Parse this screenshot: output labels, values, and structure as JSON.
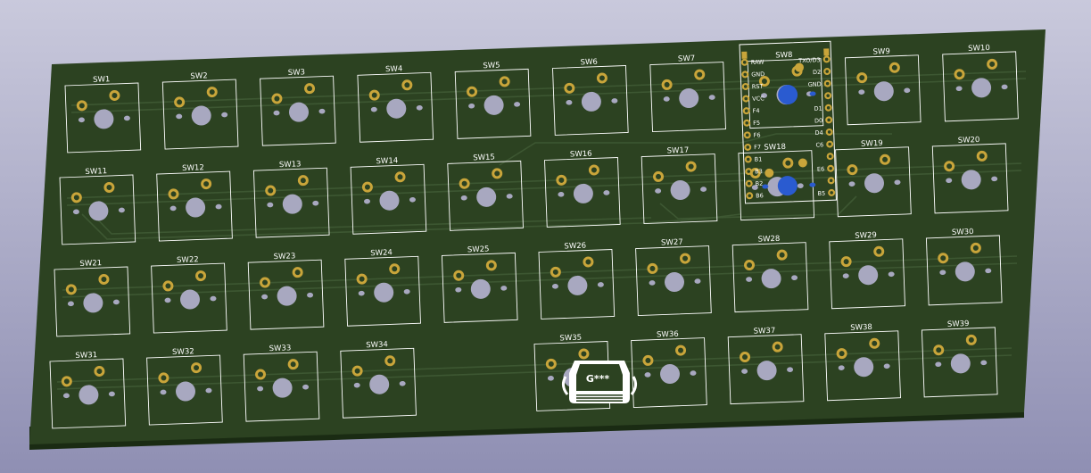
{
  "colors": {
    "background_top": "#c9c9dc",
    "background_bottom": "#8f8fb3",
    "board": "#2c4221",
    "board_edge": "#1a2b13",
    "trace": "#3f5a34",
    "silkscreen": "#ffffff",
    "pad_gold": "#c9a53a",
    "hole": "#a8a8c0",
    "mcu_hole": "#2a5bd0"
  },
  "switches": [
    {
      "label": "SW1"
    },
    {
      "label": "SW2"
    },
    {
      "label": "SW3"
    },
    {
      "label": "SW4"
    },
    {
      "label": "SW5"
    },
    {
      "label": "SW6"
    },
    {
      "label": "SW7"
    },
    {
      "label": "SW8"
    },
    {
      "label": "SW9"
    },
    {
      "label": "SW10"
    },
    {
      "label": "SW11"
    },
    {
      "label": "SW12"
    },
    {
      "label": "SW13"
    },
    {
      "label": "SW14"
    },
    {
      "label": "SW15"
    },
    {
      "label": "SW16"
    },
    {
      "label": "SW17"
    },
    {
      "label": "SW18"
    },
    {
      "label": "SW19"
    },
    {
      "label": "SW20"
    },
    {
      "label": "SW21"
    },
    {
      "label": "SW22"
    },
    {
      "label": "SW23"
    },
    {
      "label": "SW24"
    },
    {
      "label": "SW25"
    },
    {
      "label": "SW26"
    },
    {
      "label": "SW27"
    },
    {
      "label": "SW28"
    },
    {
      "label": "SW29"
    },
    {
      "label": "SW30"
    },
    {
      "label": "SW31"
    },
    {
      "label": "SW32"
    },
    {
      "label": "SW33"
    },
    {
      "label": "SW34"
    },
    {
      "label": "SW35"
    },
    {
      "label": "SW36"
    },
    {
      "label": "SW37"
    },
    {
      "label": "SW38"
    },
    {
      "label": "SW39"
    }
  ],
  "mcu": {
    "left_pins": [
      "RAW",
      "GND",
      "RST",
      "VCC",
      "F4",
      "F5",
      "F6",
      "F7",
      "B1",
      "B3",
      "B2",
      "B6"
    ],
    "right_pins": [
      "TXO/D3",
      "D2",
      "GND",
      "",
      "D1",
      "D0",
      "D4",
      "C6",
      "",
      "E6",
      "",
      "B5"
    ]
  },
  "logo": {
    "text": "G***",
    "icon": "keycap-logo-icon"
  }
}
